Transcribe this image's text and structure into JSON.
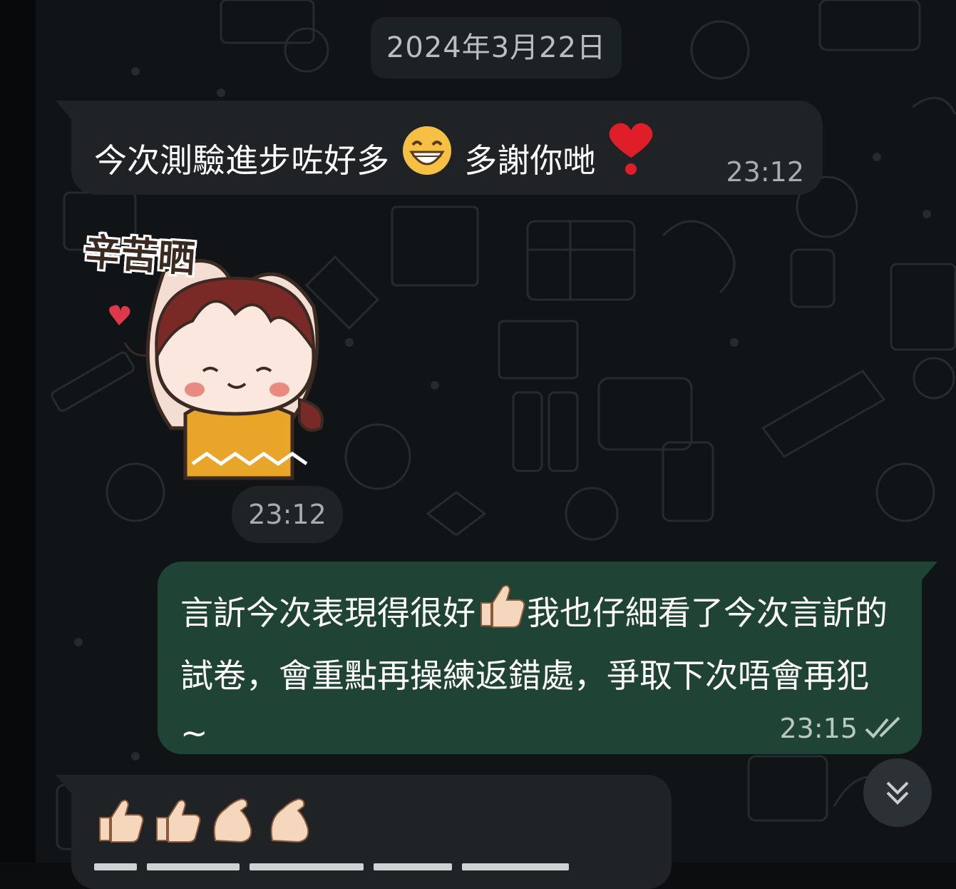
{
  "chat": {
    "date_separator": "2024年3月22日",
    "messages": [
      {
        "direction": "incoming",
        "text_before_emoji": "今次測驗進步咗好多",
        "emoji_1": "grinning-face-emoji",
        "text_after_emoji": "多謝你哋",
        "emoji_2": "red-heart-exclamation-emoji",
        "time": "23:12"
      },
      {
        "direction": "incoming",
        "type": "sticker",
        "sticker_caption": "辛苦晒",
        "time": "23:12"
      },
      {
        "direction": "outgoing",
        "text_part1": "言訢今次表現得很好",
        "emoji": "thumbs-up-emoji",
        "text_part2": "我也仔細看了今次言訢的試卷，會重點再操練返錯處，爭取下次唔會再犯~",
        "time": "23:15",
        "status": "read"
      },
      {
        "direction": "incoming",
        "emojis": [
          "thumbs-up-emoji",
          "thumbs-up-emoji",
          "flexed-biceps-emoji",
          "flexed-biceps-emoji"
        ]
      }
    ]
  },
  "colors": {
    "background": "#111416",
    "incoming_bubble": "#1f2326",
    "outgoing_bubble": "#1f4335",
    "timestamp": "#a8acaf",
    "read_ticks": "#b9c9c1"
  },
  "controls": {
    "scroll_down_icon": "double-chevron-down-icon"
  }
}
